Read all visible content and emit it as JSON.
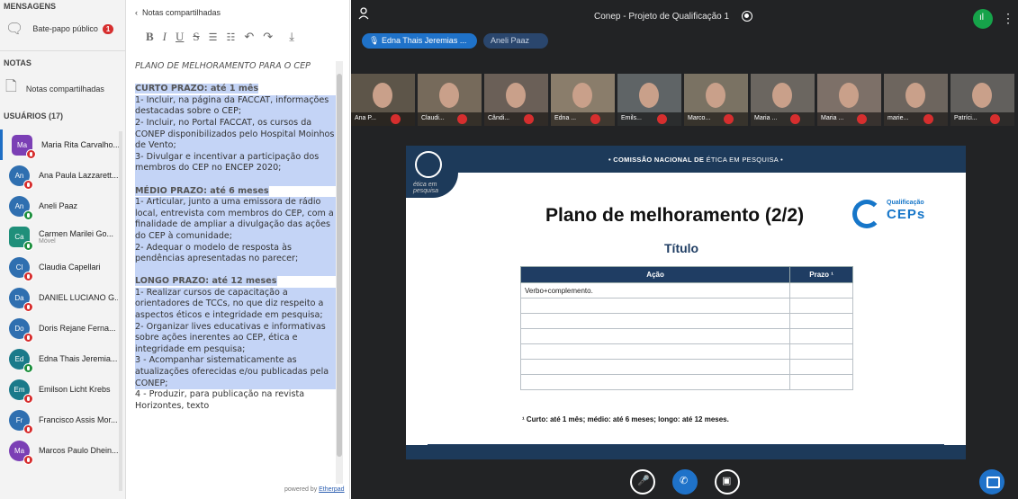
{
  "sidebar": {
    "messages_header": "MENSAGENS",
    "public_chat_label": "Bate-papo público",
    "public_chat_badge": "1",
    "notes_header": "NOTAS",
    "shared_notes_label": "Notas compartilhadas",
    "users_header": "USUÁRIOS (17)",
    "users": [
      {
        "initials": "Ma",
        "name": "Maria Rita Carvalho...",
        "color": "#7b3fb5",
        "mic": "muted",
        "sub": ""
      },
      {
        "initials": "An",
        "name": "Ana Paula Lazzarett...",
        "color": "#2f6fb0",
        "mic": "muted",
        "sub": ""
      },
      {
        "initials": "An",
        "name": "Aneli Paaz",
        "color": "#2f6fb0",
        "mic": "on",
        "sub": ""
      },
      {
        "initials": "Ca",
        "name": "Carmen Marilei Go...",
        "color": "#1f8f7a",
        "mic": "on",
        "sub": "Móvel"
      },
      {
        "initials": "Cl",
        "name": "Claudia Capellari",
        "color": "#2f6fb0",
        "mic": "muted",
        "sub": ""
      },
      {
        "initials": "Da",
        "name": "DANIEL LUCIANO G...",
        "color": "#2f6fb0",
        "mic": "muted",
        "sub": ""
      },
      {
        "initials": "Do",
        "name": "Doris Rejane Ferna...",
        "color": "#2f6fb0",
        "mic": "muted",
        "sub": ""
      },
      {
        "initials": "Ed",
        "name": "Edna Thais Jeremia...",
        "color": "#1a7a8a",
        "mic": "on",
        "sub": ""
      },
      {
        "initials": "Em",
        "name": "Emilson Licht Krebs",
        "color": "#1a7a8a",
        "mic": "muted",
        "sub": ""
      },
      {
        "initials": "Fr",
        "name": "Francisco Assis Mor...",
        "color": "#2f6fb0",
        "mic": "muted",
        "sub": ""
      },
      {
        "initials": "Ma",
        "name": "Marcos Paulo Dhein...",
        "color": "#7b3fb5",
        "mic": "muted",
        "sub": ""
      }
    ]
  },
  "notes": {
    "back_label": "Notas compartilhadas",
    "toolbar": [
      "B",
      "I",
      "U",
      "S",
      "☰",
      "☷",
      "↶",
      "↷",
      "⤓"
    ],
    "title": "PLANO DE MELHORAMENTO PARA O CEP",
    "curto_head": "CURTO PRAZO: até 1 mês",
    "curto_body": "1- Incluir, na página da FACCAT, informações destacadas sobre o CEP;\n2- Incluir, no Portal FACCAT, os cursos da CONEP disponibilizados pelo Hospital Moinhos de Vento;\n3- Divulgar e incentivar a participação dos membros do CEP no ENCEP 2020;",
    "medio_head": "MÉDIO PRAZO: até 6 meses",
    "medio_body": "1- Articular, junto a uma emissora de rádio local, entrevista com membros do CEP, com a finalidade de ampliar a divulgação das ações do CEP à comunidade;\n2- Adequar o modelo de resposta às pendências apresentadas no parecer;",
    "longo_head": "LONGO PRAZO: até 12 meses",
    "longo_body": "1- Realizar cursos de capacitação a orientadores de TCCs, no que diz respeito a aspectos éticos e integridade em pesquisa;\n2- Organizar lives educativas e informativas sobre ações inerentes ao CEP, ética e integridade em pesquisa;\n3 - Acompanhar sistematicamente as atualizações oferecidas e/ou publicadas pela CONEP;",
    "trailing": "4 - Produzir, para publicação na revista Horizontes, texto",
    "powered_prefix": "powered by ",
    "powered_link": "Etherpad"
  },
  "meeting": {
    "title": "Conep - Projeto de Qualificação 1",
    "speakers": [
      "Edna Thais Jeremias ...",
      "Aneli Paaz"
    ],
    "tiles": [
      "Ana P...",
      "Claudi...",
      "Cândi...",
      "Edna ...",
      "Emils...",
      "Marco...",
      "Maria ...",
      "Maria ...",
      "marie...",
      "Patríci..."
    ]
  },
  "slide": {
    "banner_bold": "• COMISSÃO NACIONAL DE",
    "banner_rest": " ÉTICA EM PESQUISA •",
    "logo_text": "ética em pesquisa",
    "title": "Plano de melhoramento (2/2)",
    "subtitle": "Título",
    "brand_small": "Qualificação",
    "brand_big": "CEPs",
    "table_headers": [
      "Ação",
      "Prazo ¹"
    ],
    "table_rows": [
      [
        "Verbo+complemento.",
        ""
      ],
      [
        "",
        ""
      ],
      [
        "",
        ""
      ],
      [
        "",
        ""
      ],
      [
        "",
        ""
      ],
      [
        "",
        ""
      ],
      [
        "",
        ""
      ]
    ],
    "footnote": "¹ Curto: até 1 mês; médio: até 6 meses; longo: até 12 meses."
  }
}
